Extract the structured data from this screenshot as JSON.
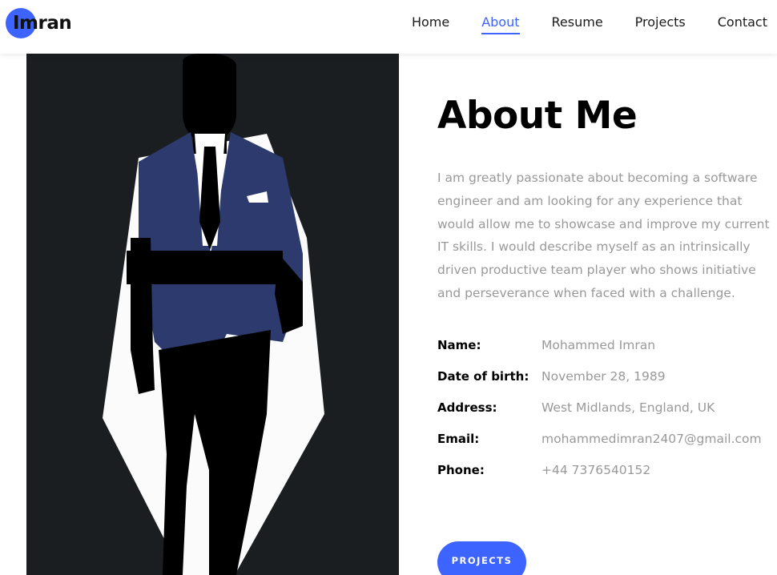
{
  "header": {
    "logo_text": "Imran",
    "nav": [
      {
        "label": "Home",
        "active": false
      },
      {
        "label": "About",
        "active": true
      },
      {
        "label": "Resume",
        "active": false
      },
      {
        "label": "Projects",
        "active": false
      },
      {
        "label": "Contact",
        "active": false
      }
    ]
  },
  "about": {
    "title": "About Me",
    "bio": "I am greatly passionate about becoming a software engineer and am looking for any experience that would allow me to showcase and improve my current IT skills. I would describe myself as an intrinsically driven productive team player who shows initiative and perseverance when faced with a challenge.",
    "details": [
      {
        "label": "Name:",
        "value": "Mohammed Imran"
      },
      {
        "label": "Date of birth:",
        "value": "November 28, 1989"
      },
      {
        "label": "Address:",
        "value": "West Midlands, England, UK"
      },
      {
        "label": "Email:",
        "value": "mohammedimran2407@gmail.com"
      },
      {
        "label": "Phone:",
        "value": "+44 7376540152"
      }
    ],
    "button_label": "PROJECTS"
  },
  "colors": {
    "accent": "#3e64ff",
    "portrait_bg": "#1b1e21",
    "suit": "#2c3a6e",
    "muted_text": "#999999"
  }
}
